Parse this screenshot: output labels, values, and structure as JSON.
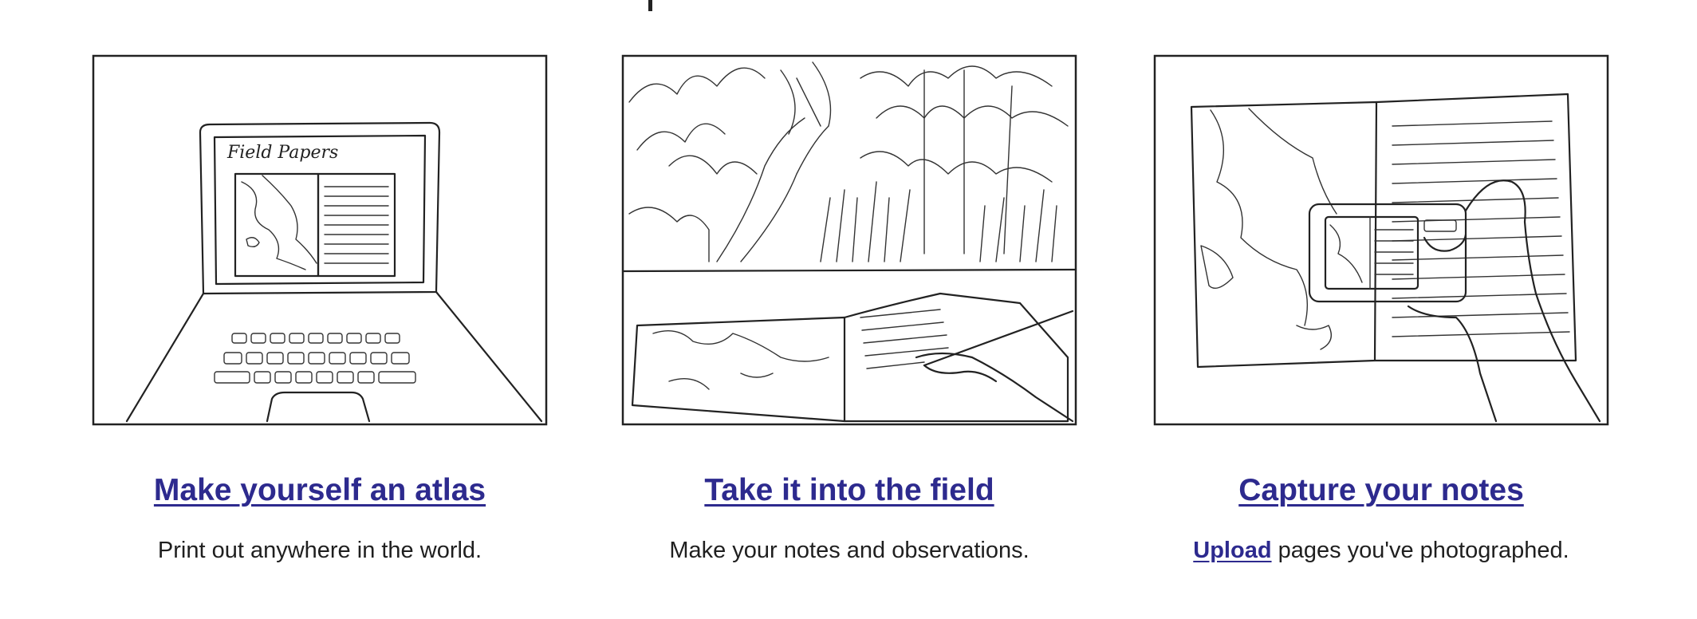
{
  "cards": [
    {
      "title": "Make yourself an atlas",
      "description": "Print out anywhere in the world.",
      "illustration": "laptop-sketch",
      "screen_text": "Field Papers"
    },
    {
      "title": "Take it into the field",
      "description": "Make your notes and observations.",
      "illustration": "field-notebook-sketch"
    },
    {
      "title": "Capture your notes",
      "description_link": "Upload",
      "description_rest": " pages you've photographed.",
      "illustration": "camera-photo-sketch"
    }
  ],
  "colors": {
    "link": "#2d2a8e",
    "text": "#1f1f1f",
    "background": "#ffffff"
  }
}
